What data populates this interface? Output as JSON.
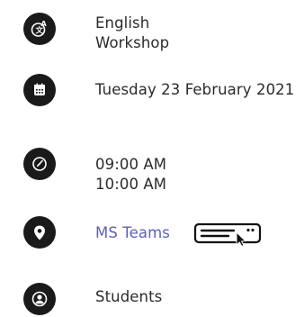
{
  "event": {
    "title_line1": "English",
    "title_line2": "Workshop",
    "date": "Tuesday 23 February 2021",
    "time_start": "09:00 AM",
    "time_end": "10:00 AM",
    "location": "MS Teams",
    "audience": "Students"
  },
  "colors": {
    "icon_background": "#1a1a1a",
    "link": "#5b5fc7",
    "text": "#2b2b2b"
  },
  "icons": {
    "title": "translate-icon",
    "date": "calendar-icon",
    "time": "clock-icon",
    "location": "map-pin-icon",
    "join": "online-meeting-icon",
    "audience": "person-icon"
  }
}
